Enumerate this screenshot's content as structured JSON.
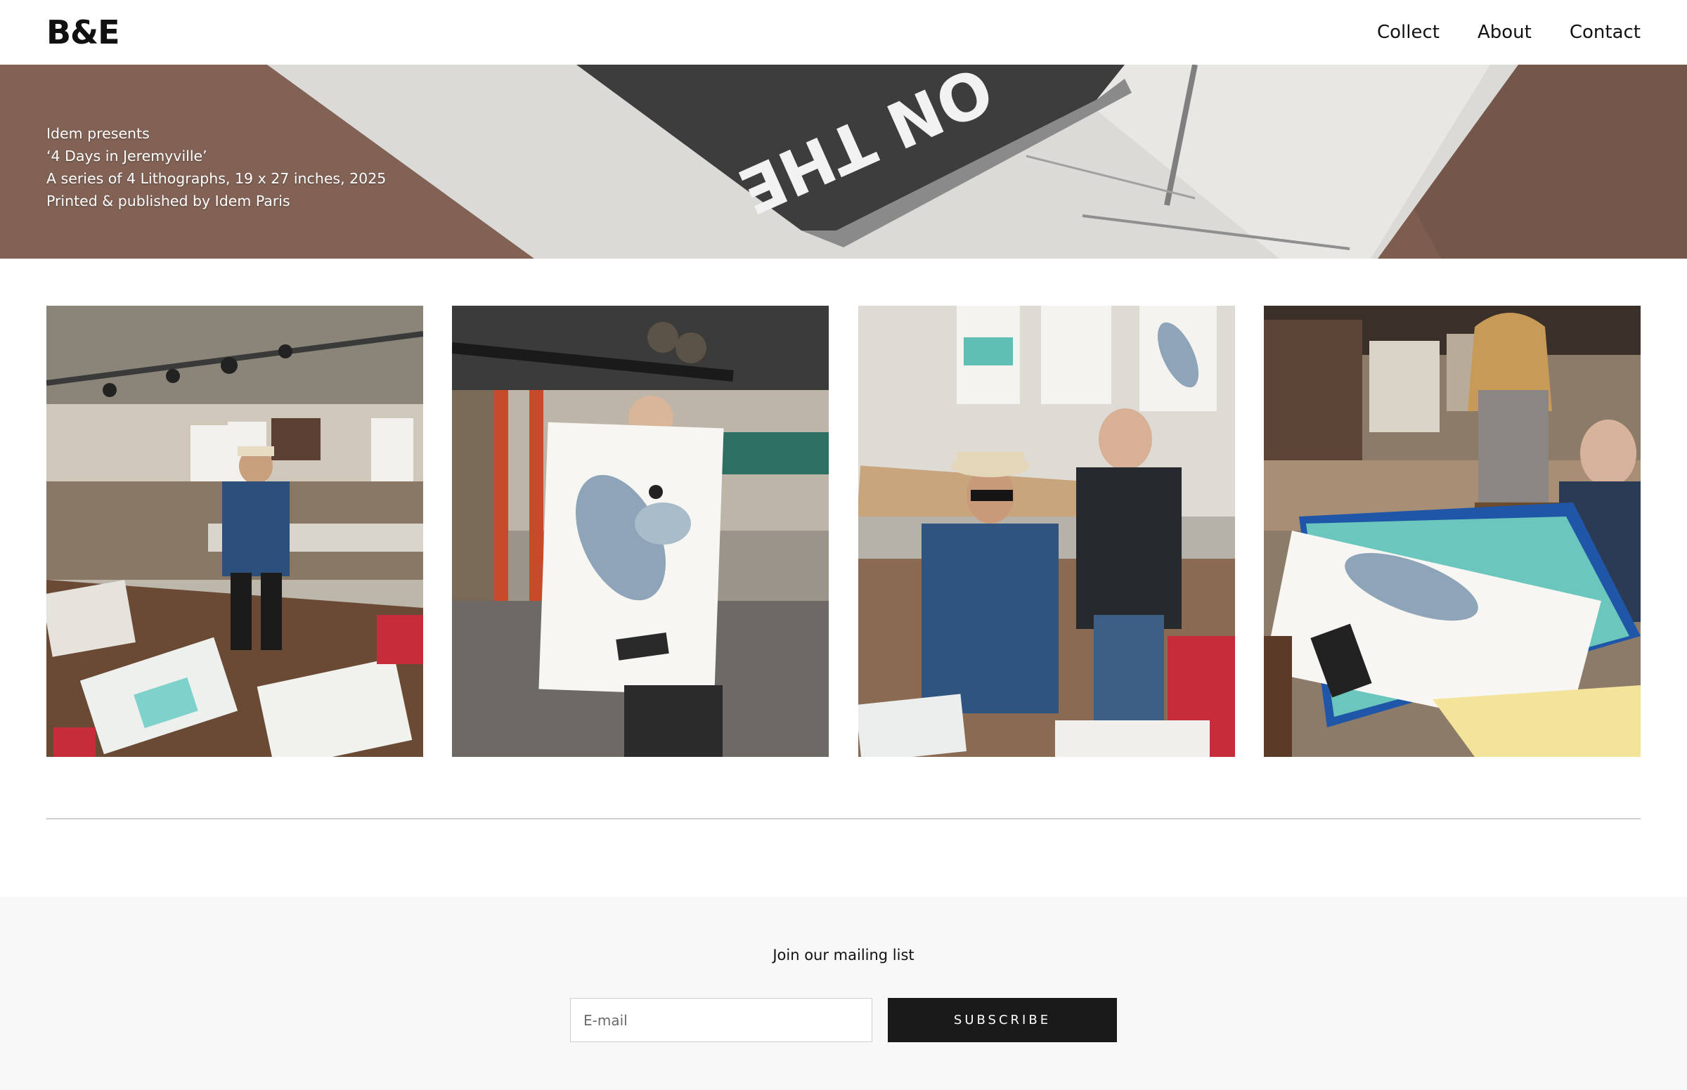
{
  "header": {
    "logo": "B&E",
    "nav": [
      {
        "label": "Collect"
      },
      {
        "label": "About"
      },
      {
        "label": "Contact"
      }
    ]
  },
  "hero": {
    "lines": [
      "Idem presents",
      "‘4 Days in Jeremyville’",
      "A series of 4 Lithographs, 19 x 27 inches, 2025",
      "Printed & published by Idem Paris"
    ],
    "print_text": "ON THE"
  },
  "gallery": {
    "photos": [
      {
        "subject": "artist-in-studio"
      },
      {
        "subject": "printer-holding-lithograph"
      },
      {
        "subject": "artist-and-printer-seated"
      },
      {
        "subject": "team-reviewing-print"
      }
    ]
  },
  "newsletter": {
    "title": "Join our mailing list",
    "email_placeholder": "E-mail",
    "subscribe_label": "SUBSCRIBE"
  },
  "colors": {
    "button_bg": "#1a1a1a",
    "newsletter_bg": "#f8f8f8",
    "hero_wood": "#7a5a4c"
  }
}
